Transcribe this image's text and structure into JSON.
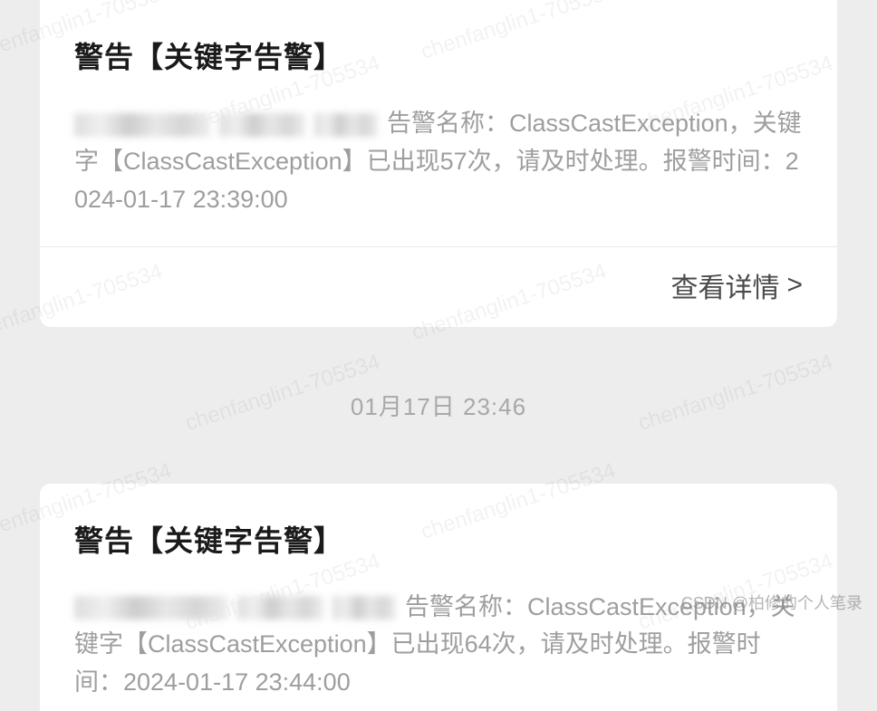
{
  "watermark": "chenfanglin1-705534",
  "csdn_credit": "CSDN @柏修的个人笔录",
  "cards": [
    {
      "title": "警告【关键字告警】",
      "body": "告警名称：ClassCastException，关键字【ClassCastException】已出现57次，请及时处理。报警时间：2024-01-17 23:39:00",
      "detail_label": "查看详情",
      "detail_chevron": ">"
    },
    {
      "title": "警告【关键字告警】",
      "body": "告警名称：ClassCastException，关键字【ClassCastException】已出现64次，请及时处理。报警时间：2024-01-17 23:44:00"
    }
  ],
  "timestamp": "01月17日 23:46"
}
